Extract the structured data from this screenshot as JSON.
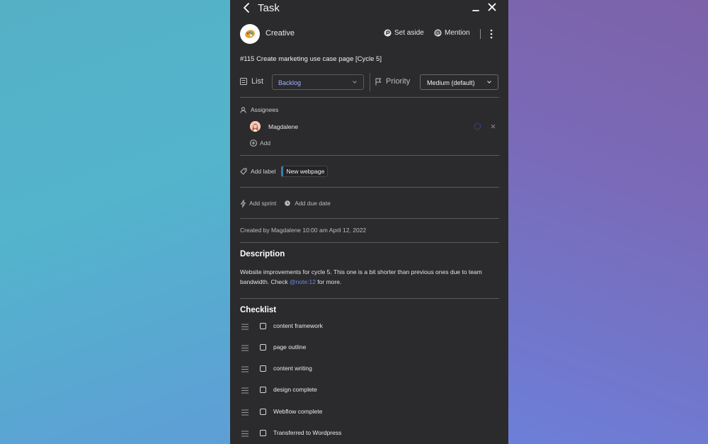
{
  "window": {
    "title": "Task"
  },
  "header": {
    "project_name": "Creative",
    "set_aside_label": "Set aside",
    "mention_label": "Mention"
  },
  "task": {
    "title": "#115 Create marketing use case page [Cycle 5]"
  },
  "fields": {
    "list_label": "List",
    "list_value": "Backlog",
    "priority_label": "Priority",
    "priority_value": "Medium (default)"
  },
  "assignees": {
    "label": "Assignees",
    "items": [
      {
        "name": "Magdalene"
      }
    ],
    "add_label": "Add"
  },
  "labels": {
    "add_label": "Add label",
    "items": [
      {
        "text": "New webpage",
        "color": "#3a7fa8"
      }
    ]
  },
  "schedule": {
    "add_sprint": "Add sprint",
    "add_due_date": "Add due date"
  },
  "meta": {
    "created_text": "Created by Magdalene 10:00 am April 12, 2022"
  },
  "description": {
    "heading": "Description",
    "text_before": "Website improvements for cycle 5. This one is a bit shorter than previous ones due to team bandwidth. Check ",
    "link_text": "@note:12",
    "text_after": " for more."
  },
  "checklist": {
    "heading": "Checklist",
    "items": [
      {
        "text": "content framework",
        "checked": false
      },
      {
        "text": "page outline",
        "checked": false
      },
      {
        "text": "content writing",
        "checked": false
      },
      {
        "text": "design complete",
        "checked": false
      },
      {
        "text": "Webflow complete",
        "checked": false
      },
      {
        "text": "Transferred to Wordpress",
        "checked": false
      }
    ]
  },
  "icons": {
    "back": "chevron-left-icon",
    "minimize": "minimize-icon",
    "close": "close-icon",
    "project": "palette-icon",
    "set_aside": "set-aside-icon",
    "mention": "at-icon",
    "more": "more-vertical-icon",
    "list": "list-icon",
    "priority": "flag-icon",
    "assignees": "user-icon",
    "add": "plus-circle-icon",
    "label": "tag-icon",
    "sprint": "bolt-icon",
    "due_date": "clock-icon",
    "drag": "drag-handle-icon"
  },
  "colors": {
    "panel_bg": "#2b2b2d",
    "link": "#6f86e8",
    "list_value": "#9fb3ff"
  }
}
